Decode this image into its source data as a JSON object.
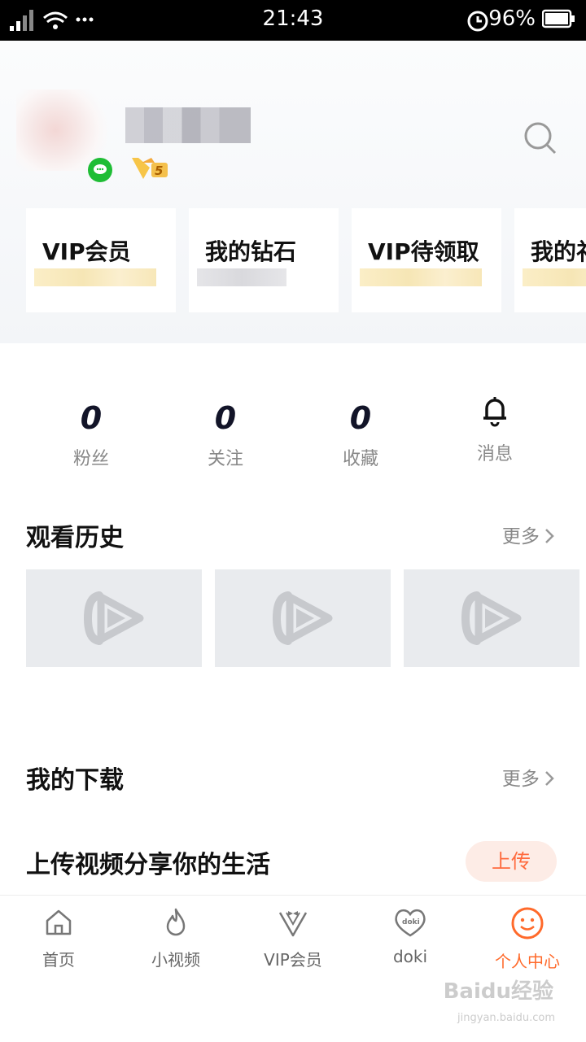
{
  "status_bar": {
    "time": "21:43",
    "battery": "96%"
  },
  "header": {
    "vip_cards": [
      {
        "label": "VIP会员",
        "blur": "yellow"
      },
      {
        "label": "我的钻石",
        "blur": "gray"
      },
      {
        "label": "VIP待领取",
        "blur": "yellow"
      },
      {
        "label": "我的礼",
        "blur": "yellow"
      }
    ]
  },
  "stats": [
    {
      "value": "0",
      "label": "粉丝"
    },
    {
      "value": "0",
      "label": "关注"
    },
    {
      "value": "0",
      "label": "收藏"
    },
    {
      "label": "消息",
      "icon": "bell-icon"
    }
  ],
  "history": {
    "title": "观看历史",
    "more": "更多"
  },
  "downloads": {
    "title": "我的下载",
    "more": "更多"
  },
  "upload": {
    "title": "上传视频分享你的生活",
    "button": "上传"
  },
  "bottom_nav": [
    {
      "label": "首页",
      "icon": "home-icon"
    },
    {
      "label": "小视频",
      "icon": "flame-icon"
    },
    {
      "label": "VIP会员",
      "icon": "vip-bowtie-icon"
    },
    {
      "label": "doki",
      "icon": "doki-heart-icon"
    },
    {
      "label": "个人中心",
      "icon": "smiley-icon",
      "active": true
    }
  ],
  "watermark": {
    "text": "Baidu经验",
    "sub": "jingyan.baidu.com"
  },
  "colors": {
    "accent": "#ff6a2b",
    "stat_number": "#121428",
    "wechat": "#1fbd35",
    "thumb_bg": "#e9ebee"
  }
}
